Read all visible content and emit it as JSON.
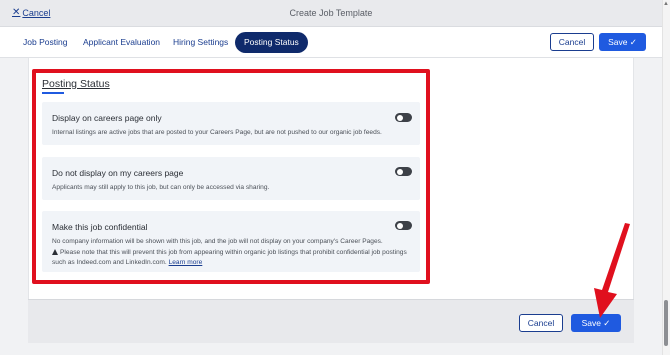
{
  "header": {
    "cancel_label": "Cancel",
    "title": "Create Job Template"
  },
  "tabs": [
    {
      "label": "Job Posting",
      "active": false
    },
    {
      "label": "Applicant Evaluation",
      "active": false
    },
    {
      "label": "Hiring Settings",
      "active": false
    },
    {
      "label": "Posting Status",
      "active": true
    }
  ],
  "toolbar": {
    "cancel_label": "Cancel",
    "save_label": "Save ✓"
  },
  "section": {
    "title": "Posting Status"
  },
  "options": [
    {
      "title": "Display on careers page only",
      "description": "Internal listings are active jobs that are posted to your Careers Page, but are not pushed to our organic job feeds.",
      "enabled": false
    },
    {
      "title": "Do not display on my careers page",
      "description": "Applicants may still apply to this job, but can only be accessed via sharing.",
      "enabled": false
    },
    {
      "title": "Make this job confidential",
      "description": "No company information will be shown with this job, and the job will not display on your company's Career Pages.",
      "warning": "Please note that this will prevent this job from appearing within organic job listings that prohibit confidential job postings such as Indeed.com and LinkedIn.com.",
      "learn_more": "Learn more",
      "enabled": false
    }
  ],
  "footer": {
    "cancel_label": "Cancel",
    "save_label": "Save ✓"
  },
  "colors": {
    "primary": "#1f5ae0",
    "active_tab": "#0f2a6b",
    "highlight": "#e0101e"
  }
}
